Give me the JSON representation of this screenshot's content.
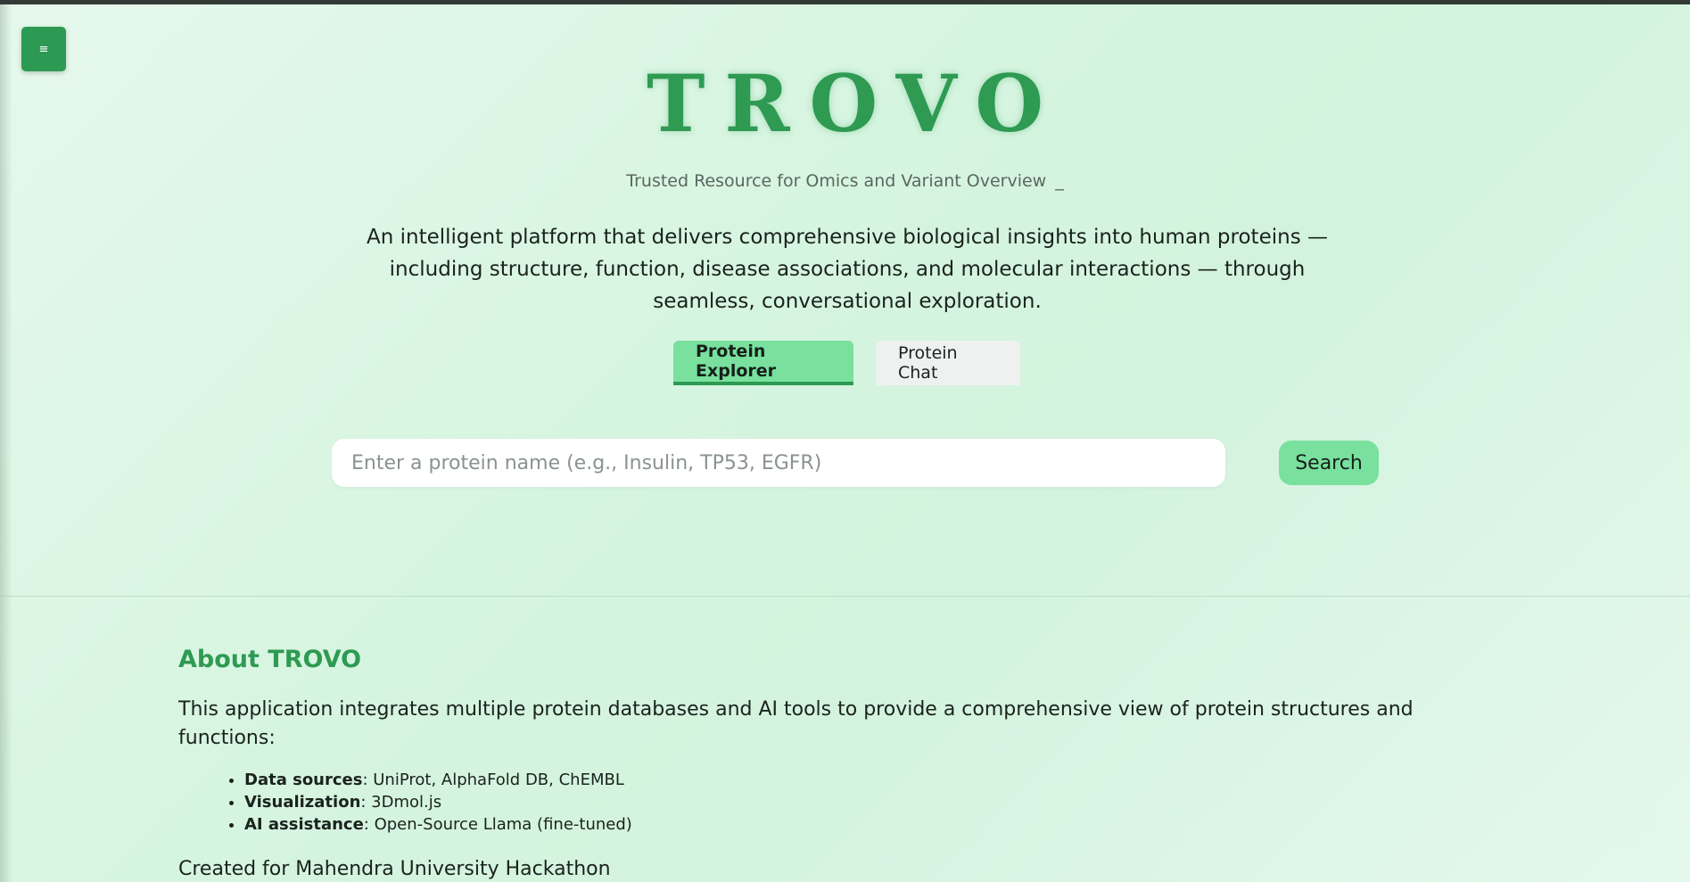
{
  "menu": {
    "icon": "hamburger-menu-icon",
    "glyph": "≡"
  },
  "header": {
    "title": "TROVO",
    "tagline": "Trusted Resource for Omics and Variant Overview",
    "cursor": "_"
  },
  "description": "An intelligent platform that delivers comprehensive biological insights into human proteins — including structure, function, disease associations, and molecular interactions — through seamless, conversational exploration.",
  "tabs": [
    {
      "label": "Protein Explorer",
      "active": true
    },
    {
      "label": "Protein Chat",
      "active": false
    }
  ],
  "search": {
    "placeholder": "Enter a protein name (e.g., Insulin, TP53, EGFR)",
    "value": "",
    "button_label": "Search"
  },
  "about": {
    "title": "About TROVO",
    "intro": "This application integrates multiple protein databases and AI tools to provide a comprehensive view of protein structures and functions:",
    "items": [
      {
        "label": "Data sources",
        "value": ": UniProt, AlphaFold DB, ChEMBL"
      },
      {
        "label": "Visualization",
        "value": ": 3Dmol.js"
      },
      {
        "label": "AI assistance",
        "value": ": Open-Source Llama (fine-tuned)"
      }
    ],
    "footer": "Created for Mahendra University Hackathon"
  },
  "colors": {
    "accent": "#2e9a52",
    "tab_active": "#79e09e",
    "background": "#d6f5e0"
  }
}
